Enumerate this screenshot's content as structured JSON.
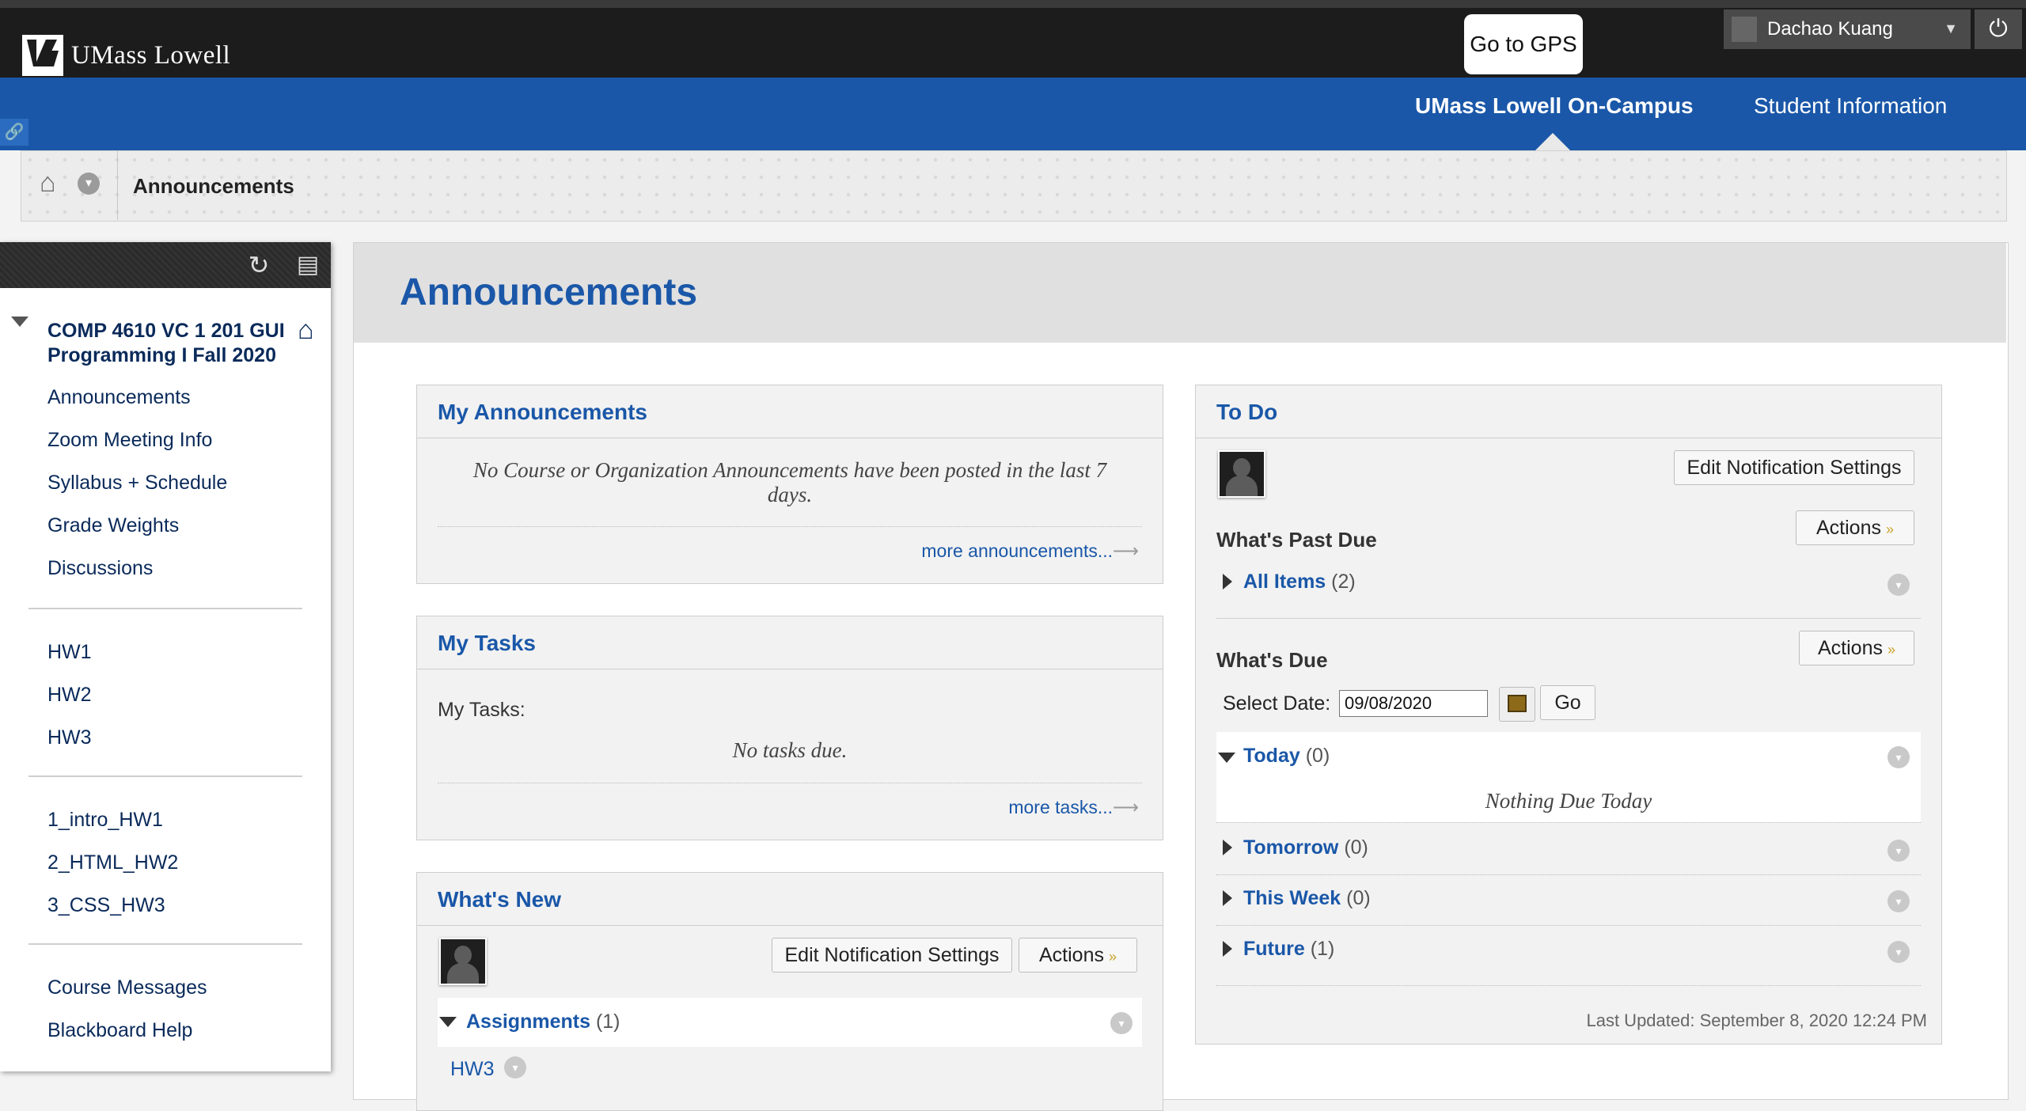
{
  "header": {
    "logo_text": "UMass Lowell",
    "logo_mark_label": "UMASS",
    "gps_button": "Go to GPS",
    "user_name": "Dachao Kuang",
    "nav_tabs": [
      "UMass Lowell On-Campus",
      "Student Information"
    ]
  },
  "breadcrumb": {
    "current": "Announcements"
  },
  "course_menu": {
    "course_title": "COMP 4610 VC 1 201 GUI Programming I Fall 2020",
    "items_group1": [
      "Announcements",
      "Zoom Meeting Info",
      "Syllabus + Schedule",
      "Grade Weights",
      "Discussions"
    ],
    "items_group2": [
      "HW1",
      "HW2",
      "HW3"
    ],
    "items_group3": [
      "1_intro_HW1",
      "2_HTML_HW2",
      "3_CSS_HW3"
    ],
    "items_group4": [
      "Course Messages",
      "Blackboard Help"
    ]
  },
  "main": {
    "page_title": "Announcements",
    "my_announcements": {
      "title": "My Announcements",
      "empty_message": "No Course or Organization Announcements have been posted in the last 7 days.",
      "more_link": "more announcements..."
    },
    "my_tasks": {
      "title": "My Tasks",
      "label": "My Tasks:",
      "empty_message": "No tasks due.",
      "more_link": "more tasks..."
    },
    "whats_new": {
      "title": "What's New",
      "edit_button": "Edit Notification Settings",
      "actions_button": "Actions",
      "assignments_label": "Assignments",
      "assignments_count": "(1)",
      "item": "HW3"
    },
    "todo": {
      "title": "To Do",
      "edit_button": "Edit Notification Settings",
      "past_due_label": "What's Past Due",
      "actions_button": "Actions",
      "all_items_label": "All Items",
      "all_items_count": "(2)",
      "whats_due_label": "What's Due",
      "select_date_label": "Select Date:",
      "date_value": "09/08/2020",
      "go_button": "Go",
      "today_label": "Today",
      "today_count": "(0)",
      "nothing_due": "Nothing Due Today",
      "tomorrow_label": "Tomorrow",
      "tomorrow_count": "(0)",
      "this_week_label": "This Week",
      "this_week_count": "(0)",
      "future_label": "Future",
      "future_count": "(1)",
      "last_updated": "Last Updated: September 8, 2020 12:24 PM"
    }
  },
  "colors": {
    "brand_blue": "#1a57a8",
    "topbar": "#1c1c1c",
    "link_navy": "#0a2a5a"
  }
}
